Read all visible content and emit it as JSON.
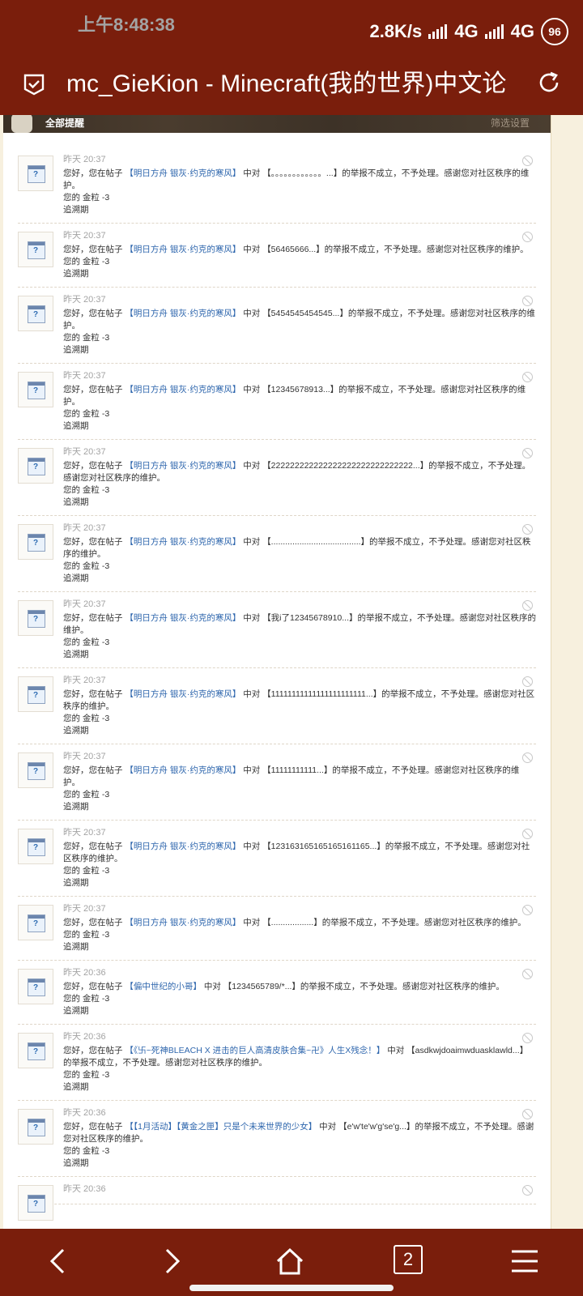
{
  "status_bar": {
    "time": "上午8:48:38",
    "speed": "2.8K/s",
    "net1": "4G",
    "net2": "4G",
    "battery": "96"
  },
  "browser": {
    "title": "mc_GieKion - Minecraft(我的世界)中文论"
  },
  "notice_header": {
    "title": "全部提醒",
    "filter": "筛选设置"
  },
  "notifications": [
    {
      "time": "昨天 20:37",
      "prefix": "您好，您在帖子",
      "thread": "【明日方舟 银灰·约克的寒风】",
      "mid": " 中对 ",
      "report": "【。。。。。。。。。。。。...】的举报不成立，不予处理。感谢您对社区秩序的维护。",
      "gold": "您的 金粒 -3",
      "tag": "追溯期"
    },
    {
      "time": "昨天 20:37",
      "prefix": "您好，您在帖子",
      "thread": "【明日方舟 银灰·约克的寒风】",
      "mid": " 中对 ",
      "report": "【56465666...】的举报不成立，不予处理。感谢您对社区秩序的维护。",
      "gold": "您的 金粒 -3",
      "tag": "追溯期"
    },
    {
      "time": "昨天 20:37",
      "prefix": "您好，您在帖子",
      "thread": "【明日方舟 银灰·约克的寒风】",
      "mid": " 中对 ",
      "report": "【5454545454545...】的举报不成立，不予处理。感谢您对社区秩序的维护。",
      "gold": "您的 金粒 -3",
      "tag": "追溯期"
    },
    {
      "time": "昨天 20:37",
      "prefix": "您好，您在帖子",
      "thread": "【明日方舟 银灰·约克的寒风】",
      "mid": " 中对 ",
      "report": "【12345678913...】的举报不成立，不予处理。感谢您对社区秩序的维护。",
      "gold": "您的 金粒 -3",
      "tag": "追溯期"
    },
    {
      "time": "昨天 20:37",
      "prefix": "您好，您在帖子",
      "thread": "【明日方舟 银灰·约克的寒风】",
      "mid": " 中对 ",
      "report": "【222222222222222222222222222222...】的举报不成立，不予处理。感谢您对社区秩序的维护。",
      "gold": "您的 金粒 -3",
      "tag": "追溯期"
    },
    {
      "time": "昨天 20:37",
      "prefix": "您好，您在帖子",
      "thread": "【明日方舟 银灰·约克的寒风】",
      "mid": " 中对 ",
      "report": "【......................................】的举报不成立，不予处理。感谢您对社区秩序的维护。",
      "gold": "您的 金粒 -3",
      "tag": "追溯期"
    },
    {
      "time": "昨天 20:37",
      "prefix": "您好，您在帖子",
      "thread": "【明日方舟 银灰·约克的寒风】",
      "mid": " 中对 ",
      "report": "【我i了12345678910...】的举报不成立，不予处理。感谢您对社区秩序的维护。",
      "gold": "您的 金粒 -3",
      "tag": "追溯期"
    },
    {
      "time": "昨天 20:37",
      "prefix": "您好，您在帖子",
      "thread": "【明日方舟 银灰·约克的寒风】",
      "mid": " 中对 ",
      "report": "【11111111111111111111111...】的举报不成立，不予处理。感谢您对社区秩序的维护。",
      "gold": "您的 金粒 -3",
      "tag": "追溯期"
    },
    {
      "time": "昨天 20:37",
      "prefix": "您好，您在帖子",
      "thread": "【明日方舟 银灰·约克的寒风】",
      "mid": " 中对 ",
      "report": "【11111111111...】的举报不成立，不予处理。感谢您对社区秩序的维护。",
      "gold": "您的 金粒 -3",
      "tag": "追溯期"
    },
    {
      "time": "昨天 20:37",
      "prefix": "您好，您在帖子",
      "thread": "【明日方舟 银灰·约克的寒风】",
      "mid": " 中对 ",
      "report": "【123163165165165161165...】的举报不成立，不予处理。感谢您对社区秩序的维护。",
      "gold": "您的 金粒 -3",
      "tag": "追溯期"
    },
    {
      "time": "昨天 20:37",
      "prefix": "您好，您在帖子",
      "thread": "【明日方舟 银灰·约克的寒风】",
      "mid": " 中对 ",
      "report": "【..................】的举报不成立，不予处理。感谢您对社区秩序的维护。",
      "gold": "您的 金粒 -3",
      "tag": "追溯期"
    },
    {
      "time": "昨天 20:36",
      "prefix": "您好，您在帖子",
      "thread": "【偏中世纪的小哥】",
      "mid": " 中对 ",
      "report": "【1234565789/*...】的举报不成立，不予处理。感谢您对社区秩序的维护。",
      "gold": "您的 金粒 -3",
      "tag": "追溯期"
    },
    {
      "time": "昨天 20:36",
      "prefix": "您好，您在帖子",
      "thread": "【《卐~死神BLEACH X 进击的巨人高清皮肤合集~卍》人生X残念！】",
      "mid": " 中对 ",
      "report": "【asdkwjdoaimwduasklawld...】的举报不成立，不予处理。感谢您对社区秩序的维护。",
      "gold": "您的 金粒 -3",
      "tag": "追溯期"
    },
    {
      "time": "昨天 20:36",
      "prefix": "您好，您在帖子",
      "thread": "【【1月活动】【黄金之匣】只是个未来世界的少女】",
      "mid": " 中对 ",
      "report": "【e'w'te'w'g'se'g...】的举报不成立，不予处理。感谢您对社区秩序的维护。",
      "gold": "您的 金粒 -3",
      "tag": "追溯期"
    },
    {
      "time": "昨天 20:36",
      "prefix": "",
      "thread": "",
      "mid": "",
      "report": "",
      "gold": "",
      "tag": ""
    }
  ],
  "nav": {
    "tab_count": "2"
  }
}
